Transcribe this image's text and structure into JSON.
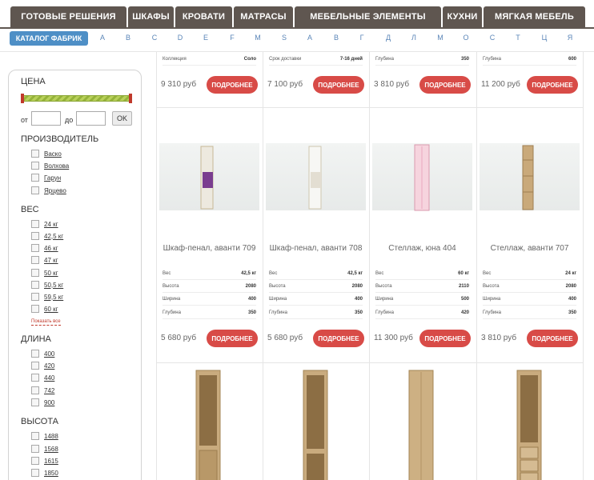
{
  "nav": [
    {
      "label": "Готовые решения"
    },
    {
      "label": "Шкафы"
    },
    {
      "label": "Кровати"
    },
    {
      "label": "Матрасы"
    },
    {
      "label": "Мебельные элементы"
    },
    {
      "label": "Кухни"
    },
    {
      "label": "Мягкая мебель"
    }
  ],
  "alphabet": {
    "catalog_label": "Каталог фабрик",
    "letters": [
      "A",
      "B",
      "C",
      "D",
      "E",
      "F",
      "M",
      "S",
      "А",
      "В",
      "Г",
      "Д",
      "Л",
      "М",
      "О",
      "С",
      "Т",
      "Ц",
      "Я"
    ]
  },
  "filters": {
    "price": {
      "title": "Цена",
      "from_label": "от",
      "to_label": "до",
      "ok_label": "OK",
      "from_value": "",
      "to_value": ""
    },
    "manufacturer": {
      "title": "Производитель",
      "items": [
        "Васко",
        "Волхова",
        "Гарун",
        "Ярцево"
      ]
    },
    "weight": {
      "title": "Вес",
      "items": [
        "24 кг",
        "42,5 кг",
        "46 кг",
        "47 кг",
        "50 кг",
        "50,5 кг",
        "59,5 кг",
        "60 кг"
      ],
      "show_all": "Показать все"
    },
    "length": {
      "title": "Длина",
      "items": [
        "400",
        "420",
        "440",
        "742",
        "900"
      ]
    },
    "height": {
      "title": "Высота",
      "items": [
        "1488",
        "1568",
        "1615",
        "1850"
      ]
    }
  },
  "buttons": {
    "more_label": "Подробнее"
  },
  "top_row": [
    {
      "spec_label": "Коллекция",
      "spec_value": "Соло",
      "price": "9 310 руб"
    },
    {
      "spec_label": "Срок доставки",
      "spec_value": "7-16 дней",
      "price": "7 100 руб"
    },
    {
      "spec_label": "Глубина",
      "spec_value": "350",
      "price": "3 810 руб"
    },
    {
      "spec_label": "Глубина",
      "spec_value": "600",
      "price": "11 200 руб"
    }
  ],
  "products": [
    {
      "name": "Шкаф-пенал, аванти 709",
      "price": "5 680 руб",
      "accent": "#7a3d8f",
      "specs": [
        {
          "label": "Вес",
          "value": "42,5 кг"
        },
        {
          "label": "Высота",
          "value": "2080"
        },
        {
          "label": "Ширина",
          "value": "400"
        },
        {
          "label": "Глубина",
          "value": "350"
        }
      ]
    },
    {
      "name": "Шкаф-пенал, аванти 708",
      "price": "5 680 руб",
      "accent": "#ffffff",
      "specs": [
        {
          "label": "Вес",
          "value": "42,5 кг"
        },
        {
          "label": "Высота",
          "value": "2080"
        },
        {
          "label": "Ширина",
          "value": "400"
        },
        {
          "label": "Глубина",
          "value": "350"
        }
      ]
    },
    {
      "name": "Стеллаж, юна 404",
      "price": "11 300 руб",
      "accent": "#f3b5c8",
      "specs": [
        {
          "label": "Вес",
          "value": "60 кг"
        },
        {
          "label": "Высота",
          "value": "2110"
        },
        {
          "label": "Ширина",
          "value": "500"
        },
        {
          "label": "Глубина",
          "value": "420"
        }
      ]
    },
    {
      "name": "Стеллаж, аванти 707",
      "price": "3 810 руб",
      "accent": "#c9a97a",
      "specs": [
        {
          "label": "Вес",
          "value": "24 кг"
        },
        {
          "label": "Высота",
          "value": "2080"
        },
        {
          "label": "Ширина",
          "value": "400"
        },
        {
          "label": "Глубина",
          "value": "350"
        }
      ]
    }
  ],
  "colors": {
    "nav_bg": "#5f5650",
    "catalog_btn": "#4e8fc6",
    "more_btn": "#d84b47",
    "letter": "#5b86b8",
    "wood": "#c9ab7e"
  }
}
